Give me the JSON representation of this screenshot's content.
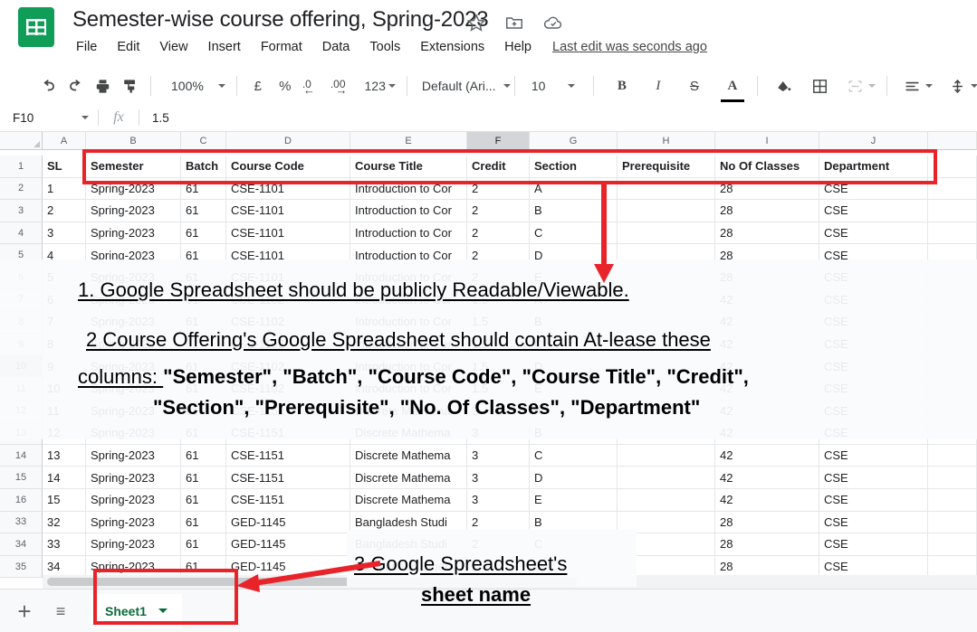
{
  "app": {
    "name": "Google Sheets",
    "doc_title": "Semester-wise course offering, Spring-2023",
    "logo_icon": "sheets-logo-icon",
    "title_icons": [
      "star-icon",
      "move-to-folder-icon",
      "cloud-saved-icon"
    ],
    "last_edit": "Last edit was seconds ago"
  },
  "menu": {
    "items": [
      "File",
      "Edit",
      "View",
      "Insert",
      "Format",
      "Data",
      "Tools",
      "Extensions",
      "Help"
    ]
  },
  "toolbar": {
    "undo_icon": "undo-icon",
    "redo_icon": "redo-icon",
    "print_icon": "print-icon",
    "paint_format_icon": "paint-format-icon",
    "zoom_value": "100%",
    "currency_label": "£",
    "percent_label": "%",
    "decrease_decimal_label": ".0",
    "increase_decimal_label": ".00",
    "more_formats_label": "123",
    "font_family_value": "Default (Ari...",
    "font_size_value": "10",
    "bold_label": "B",
    "italic_label": "I",
    "strikethrough_label": "S",
    "text_color_label": "A",
    "fill_color_icon": "fill-color-icon",
    "borders_icon": "borders-icon",
    "merge_cells_icon": "merge-cells-icon",
    "horizontal_align_icon": "horizontal-align-icon",
    "vertical_align_icon": "vertical-align-icon",
    "text_rotation_icon": "text-rotation-icon"
  },
  "formula_bar": {
    "name_box_value": "F10",
    "fx_label": "fx",
    "formula_value": "1.5"
  },
  "grid": {
    "column_letters": [
      "A",
      "B",
      "C",
      "D",
      "E",
      "F",
      "G",
      "H",
      "I",
      "J"
    ],
    "selected_column": "F",
    "selected_row": "10",
    "header_row_number": "1",
    "headers": [
      "SL",
      "Semester",
      "Batch",
      "Course Code",
      "Course Title",
      "Credit",
      "Section",
      "Prerequisite",
      "No Of Classes",
      "Department"
    ],
    "rows": [
      {
        "n": "2",
        "cells": [
          "1",
          "Spring-2023",
          "61",
          "CSE-1101",
          "Introduction to Cor",
          "2",
          "A",
          "",
          "28",
          "CSE"
        ]
      },
      {
        "n": "3",
        "cells": [
          "2",
          "Spring-2023",
          "61",
          "CSE-1101",
          "Introduction to Cor",
          "2",
          "B",
          "",
          "28",
          "CSE"
        ]
      },
      {
        "n": "4",
        "cells": [
          "3",
          "Spring-2023",
          "61",
          "CSE-1101",
          "Introduction to Cor",
          "2",
          "C",
          "",
          "28",
          "CSE"
        ]
      },
      {
        "n": "5",
        "cells": [
          "4",
          "Spring-2023",
          "61",
          "CSE-1101",
          "Introduction to Cor",
          "2",
          "D",
          "",
          "28",
          "CSE"
        ]
      },
      {
        "n": "6",
        "cells": [
          "5",
          "Spring-2023",
          "61",
          "CSE-1101",
          "Introduction to Cor",
          "2",
          "E",
          "",
          "28",
          "CSE"
        ]
      },
      {
        "n": "7",
        "cells": [
          "6",
          "Spring-2023",
          "61",
          "CSE-1102",
          "Introduction to Cor",
          "1.5",
          "A",
          "",
          "42",
          "CSE"
        ]
      },
      {
        "n": "8",
        "cells": [
          "7",
          "Spring-2023",
          "61",
          "CSE-1102",
          "Introduction to Cor",
          "1.5",
          "B",
          "",
          "42",
          "CSE"
        ]
      },
      {
        "n": "9",
        "cells": [
          "8",
          "Spring-2023",
          "61",
          "CSE-1102",
          "Introduction to Cor",
          "1.5",
          "C",
          "",
          "42",
          "CSE"
        ]
      },
      {
        "n": "10",
        "cells": [
          "9",
          "Spring-2023",
          "61",
          "CSE-1102",
          "Introduction to Cor",
          "1.5",
          "D",
          "",
          "42",
          "CSE"
        ]
      },
      {
        "n": "11",
        "cells": [
          "10",
          "Spring-2023",
          "61",
          "CSE-1102",
          "Introduction to Cor",
          "1.5",
          "E",
          "",
          "42",
          "CSE"
        ]
      },
      {
        "n": "12",
        "cells": [
          "11",
          "Spring-2023",
          "61",
          "CSE-1151",
          "Discrete Mathema",
          "3",
          "A",
          "",
          "42",
          "CSE"
        ]
      },
      {
        "n": "13",
        "cells": [
          "12",
          "Spring-2023",
          "61",
          "CSE-1151",
          "Discrete Mathema",
          "3",
          "B",
          "",
          "42",
          "CSE"
        ]
      },
      {
        "n": "14",
        "cells": [
          "13",
          "Spring-2023",
          "61",
          "CSE-1151",
          "Discrete Mathema",
          "3",
          "C",
          "",
          "42",
          "CSE"
        ]
      },
      {
        "n": "15",
        "cells": [
          "14",
          "Spring-2023",
          "61",
          "CSE-1151",
          "Discrete Mathema",
          "3",
          "D",
          "",
          "42",
          "CSE"
        ]
      },
      {
        "n": "16",
        "cells": [
          "15",
          "Spring-2023",
          "61",
          "CSE-1151",
          "Discrete Mathema",
          "3",
          "E",
          "",
          "42",
          "CSE"
        ]
      },
      {
        "n": "33",
        "cells": [
          "32",
          "Spring-2023",
          "61",
          "GED-1145",
          "Bangladesh Studi",
          "2",
          "B",
          "",
          "28",
          "CSE"
        ]
      },
      {
        "n": "34",
        "cells": [
          "33",
          "Spring-2023",
          "61",
          "GED-1145",
          "Bangladesh Studi",
          "2",
          "C",
          "",
          "28",
          "CSE"
        ]
      },
      {
        "n": "35",
        "cells": [
          "34",
          "Spring-2023",
          "61",
          "GED-1145",
          "Bangladesh Studi",
          "2",
          "D",
          "",
          "28",
          "CSE"
        ]
      }
    ]
  },
  "bottom": {
    "add_sheet_icon": "add-sheet-icon",
    "all_sheets_icon": "all-sheets-icon",
    "sheet_tab_name": "Sheet1",
    "sheet_tab_caret_icon": "chevron-down-icon"
  },
  "annotations": {
    "line1": "1. Google Spreadsheet should be publicly Readable/Viewable.",
    "line2": "2 Course Offering's Google Spreadsheet should contain At-lease these",
    "line3_prefix": "columns: ",
    "line3_bold": "\"Semester\", \"Batch\", \"Course Code\", \"Course Title\", \"Credit\",",
    "line4": "\"Section\", \"Prerequisite\", \"No. Of Classes\", \"Department\"",
    "line5": "3 Google Spreadsheet's",
    "line6": "sheet name",
    "accent_color": "#e8242a"
  }
}
